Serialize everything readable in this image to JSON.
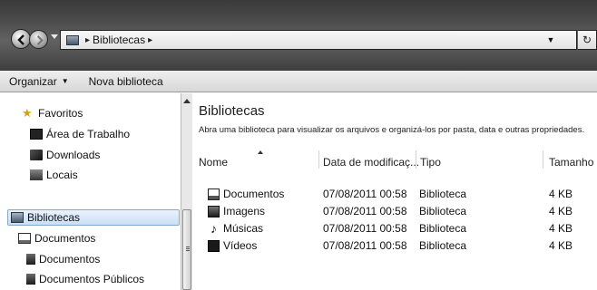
{
  "address_bar": {
    "breadcrumb": [
      "Bibliotecas"
    ],
    "separator": "▸",
    "refresh_icon": "refresh-icon",
    "dropdown_icon": "chevron-down-icon"
  },
  "toolbar": {
    "organize_label": "Organizar",
    "new_library_label": "Nova biblioteca"
  },
  "navigation": {
    "favorites": {
      "label": "Favoritos",
      "items": [
        {
          "label": "Área de Trabalho",
          "icon": "desktop-icon"
        },
        {
          "label": "Downloads",
          "icon": "downloads-icon"
        },
        {
          "label": "Locais",
          "icon": "places-icon"
        }
      ]
    },
    "libraries": {
      "label": "Bibliotecas",
      "items": [
        {
          "label": "Documentos",
          "icon": "documents-icon"
        },
        {
          "label": "Documentos",
          "icon": "documents-folder-icon"
        },
        {
          "label": "Documentos Públicos",
          "icon": "public-documents-icon"
        }
      ]
    }
  },
  "content": {
    "title": "Bibliotecas",
    "description": "Abra uma biblioteca para visualizar os arquivos e organizá-los por pasta, data e outras propriedades.",
    "columns": [
      "Nome",
      "Data de modificaç...",
      "Tipo",
      "Tamanho"
    ],
    "rows": [
      {
        "name": "Documentos",
        "date": "07/08/2011 00:58",
        "type": "Biblioteca",
        "size": "4 KB",
        "icon": "documents-library-icon"
      },
      {
        "name": "Imagens",
        "date": "07/08/2011 00:58",
        "type": "Biblioteca",
        "size": "4 KB",
        "icon": "pictures-library-icon"
      },
      {
        "name": "Músicas",
        "date": "07/08/2011 00:58",
        "type": "Biblioteca",
        "size": "4 KB",
        "icon": "music-library-icon"
      },
      {
        "name": "Vídeos",
        "date": "07/08/2011 00:58",
        "type": "Biblioteca",
        "size": "4 KB",
        "icon": "videos-library-icon"
      }
    ]
  }
}
